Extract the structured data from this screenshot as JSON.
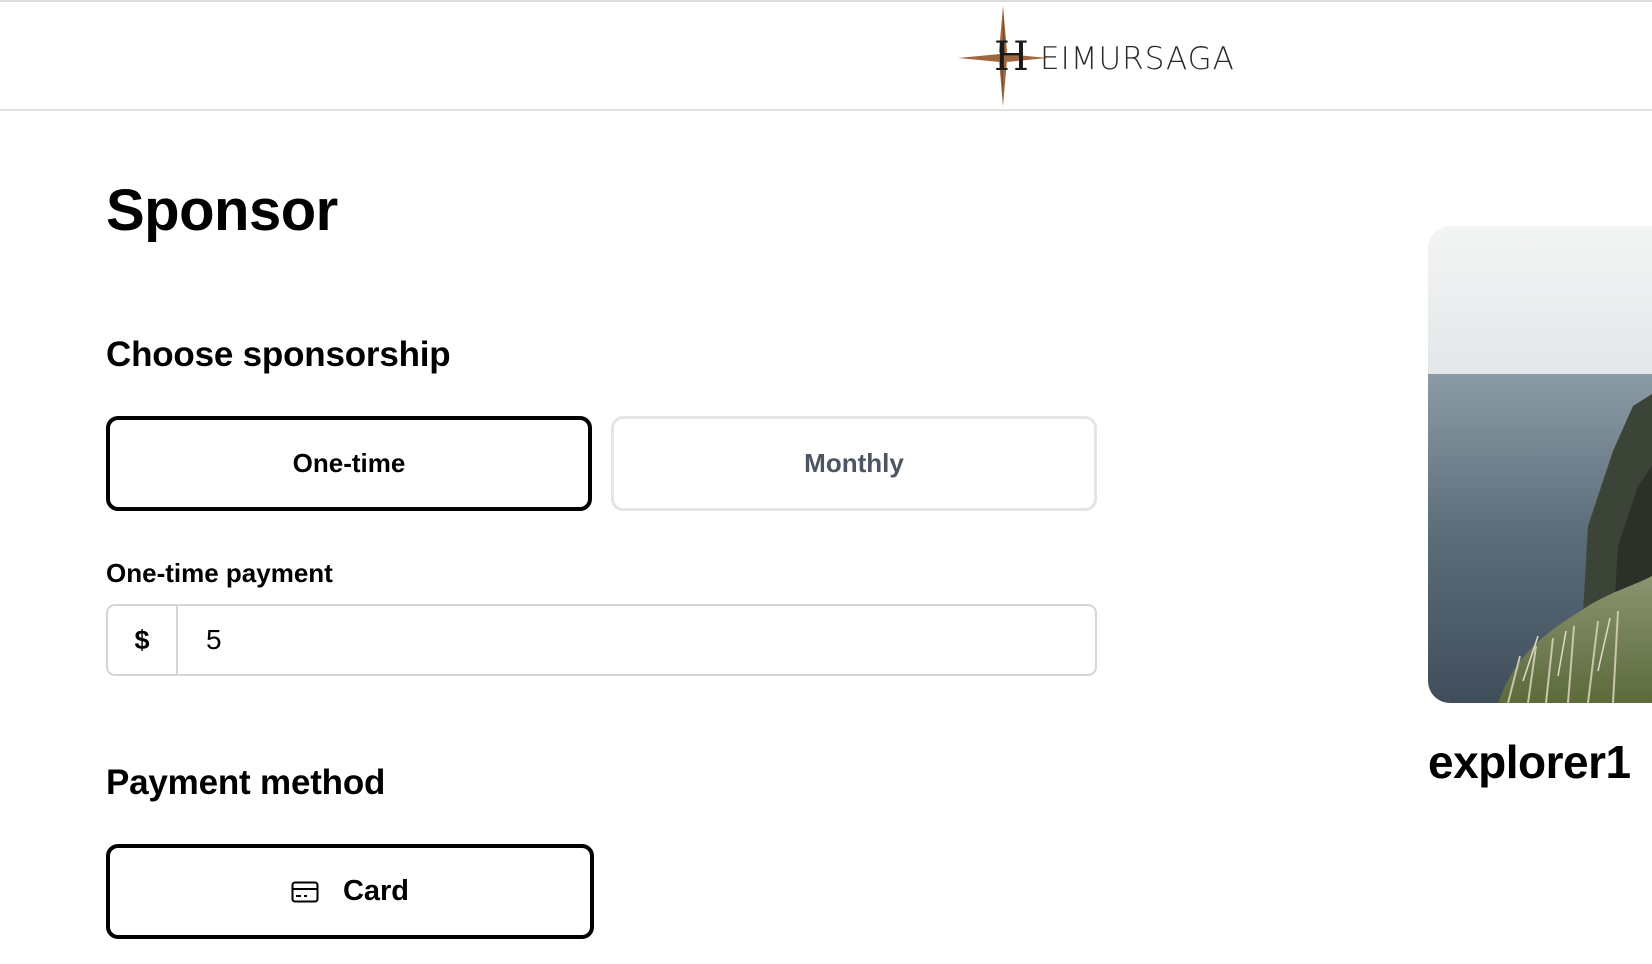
{
  "header": {
    "logo_initial": "H",
    "logo_rest": "EIMURSAGA",
    "logo_accent_color": "#a0673e"
  },
  "page": {
    "title": "Sponsor"
  },
  "sponsorship": {
    "heading": "Choose sponsorship",
    "options": [
      {
        "label": "One-time",
        "selected": true
      },
      {
        "label": "Monthly",
        "selected": false
      }
    ]
  },
  "payment": {
    "label": "One-time payment",
    "currency_symbol": "$",
    "amount": "5"
  },
  "method": {
    "heading": "Payment method",
    "card_label": "Card",
    "card_icon": "credit-card-icon"
  },
  "explorer": {
    "username": "explorer1"
  }
}
